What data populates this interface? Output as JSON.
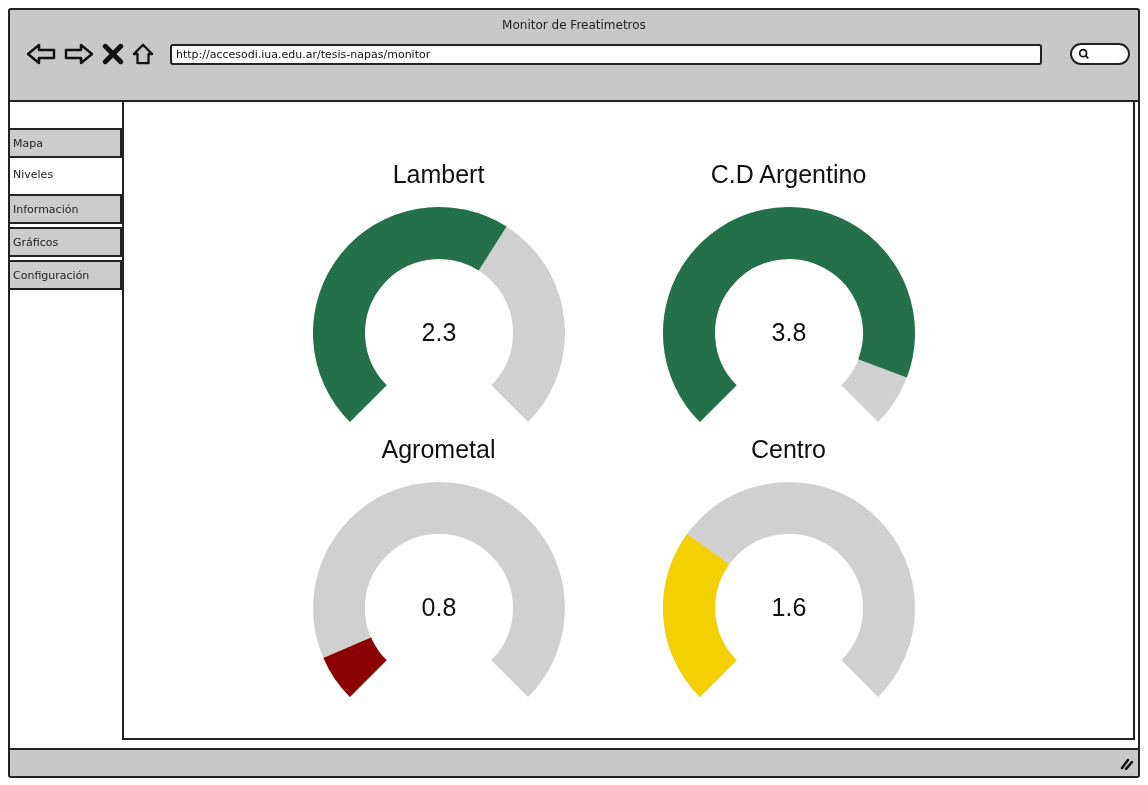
{
  "window": {
    "title": "Monitor de Freatimetros",
    "url": "http://accesodi.iua.edu.ar/tesis-napas/monitor"
  },
  "tabs": [
    {
      "label": "Mapa",
      "selected": false
    },
    {
      "label": "Niveles",
      "selected": true
    },
    {
      "label": "Información",
      "selected": false
    },
    {
      "label": "Gráficos",
      "selected": false
    },
    {
      "label": "Configuración",
      "selected": false
    }
  ],
  "gauges": [
    {
      "title": "Lambert",
      "value": "2.3"
    },
    {
      "title": "C.D Argentino",
      "value": "3.8"
    },
    {
      "title": "Agrometal",
      "value": "0.8"
    },
    {
      "title": "Centro",
      "value": "1.6"
    }
  ]
}
